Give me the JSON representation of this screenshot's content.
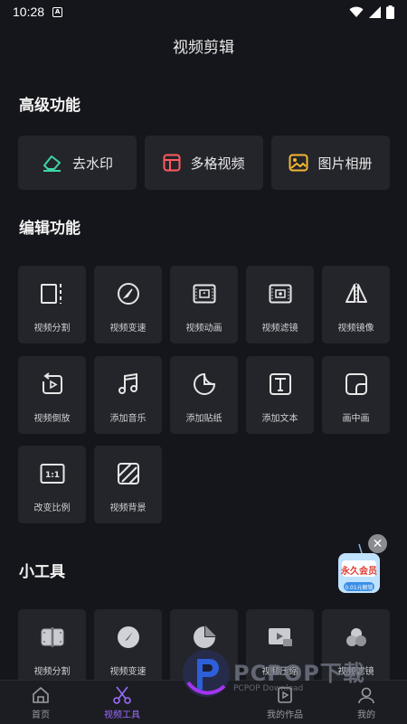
{
  "status": {
    "time": "10:28"
  },
  "header": {
    "title": "视频剪辑"
  },
  "advanced": {
    "title": "高级功能",
    "items": [
      {
        "label": "去水印",
        "icon": "eraser-icon"
      },
      {
        "label": "多格视频",
        "icon": "grid-layout-icon"
      },
      {
        "label": "图片相册",
        "icon": "image-album-icon"
      }
    ]
  },
  "edit": {
    "title": "编辑功能",
    "items": [
      {
        "label": "视频分割",
        "icon": "split-icon"
      },
      {
        "label": "视频变速",
        "icon": "speedometer-icon"
      },
      {
        "label": "视频动画",
        "icon": "animation-icon"
      },
      {
        "label": "视频滤镜",
        "icon": "filter-icon"
      },
      {
        "label": "视频镜像",
        "icon": "mirror-icon"
      },
      {
        "label": "视频倒放",
        "icon": "reverse-play-icon"
      },
      {
        "label": "添加音乐",
        "icon": "music-note-icon"
      },
      {
        "label": "添加贴纸",
        "icon": "sticker-icon"
      },
      {
        "label": "添加文本",
        "icon": "text-icon"
      },
      {
        "label": "画中画",
        "icon": "picture-in-picture-icon"
      },
      {
        "label": "改变比例",
        "icon": "ratio-icon"
      },
      {
        "label": "视频背景",
        "icon": "background-icon"
      }
    ]
  },
  "small_tools": {
    "title": "小工具",
    "items": [
      {
        "label": "视频分割",
        "icon": "split-3d-icon"
      },
      {
        "label": "视频变速",
        "icon": "speed-3d-icon"
      },
      {
        "label": "",
        "icon": "sticker-3d-icon"
      },
      {
        "label": "视频压缩",
        "icon": "video-3d-icon"
      },
      {
        "label": "视频滤镜",
        "icon": "filter-3d-icon"
      }
    ]
  },
  "promo": {
    "badge": "永久会员",
    "sub": "0.01元解锁"
  },
  "watermark": {
    "text": "PCPOP下载",
    "sub": "PCPOP Download"
  },
  "nav": {
    "items": [
      {
        "label": "首页",
        "icon": "home-icon"
      },
      {
        "label": "视频工具",
        "icon": "scissors-icon",
        "active": true
      },
      {
        "label": "我的作品",
        "icon": "works-icon"
      },
      {
        "label": "我的",
        "icon": "user-icon"
      }
    ]
  },
  "colors": {
    "accent": "#9b6cff",
    "background": "#15161b",
    "card": "#24252b"
  }
}
